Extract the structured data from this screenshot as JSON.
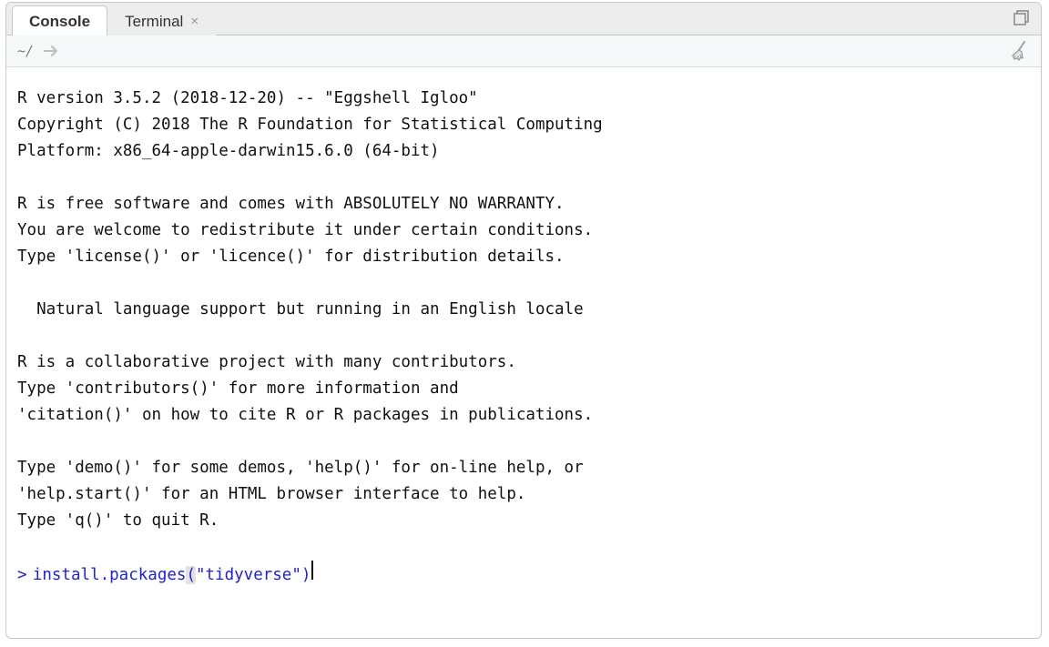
{
  "tabs": {
    "console": "Console",
    "terminal": "Terminal"
  },
  "toolbar": {
    "working_dir": "~/"
  },
  "startup_text": "R version 3.5.2 (2018-12-20) -- \"Eggshell Igloo\"\nCopyright (C) 2018 The R Foundation for Statistical Computing\nPlatform: x86_64-apple-darwin15.6.0 (64-bit)\n\nR is free software and comes with ABSOLUTELY NO WARRANTY.\nYou are welcome to redistribute it under certain conditions.\nType 'license()' or 'licence()' for distribution details.\n\n  Natural language support but running in an English locale\n\nR is a collaborative project with many contributors.\nType 'contributors()' for more information and\n'citation()' on how to cite R or R packages in publications.\n\nType 'demo()' for some demos, 'help()' for on-line help, or\n'help.start()' for an HTML browser interface to help.\nType 'q()' to quit R.\n",
  "input": {
    "prompt": ">",
    "fn": "install.packages",
    "open": "(",
    "arg": "\"tidyverse\"",
    "close": ")"
  }
}
